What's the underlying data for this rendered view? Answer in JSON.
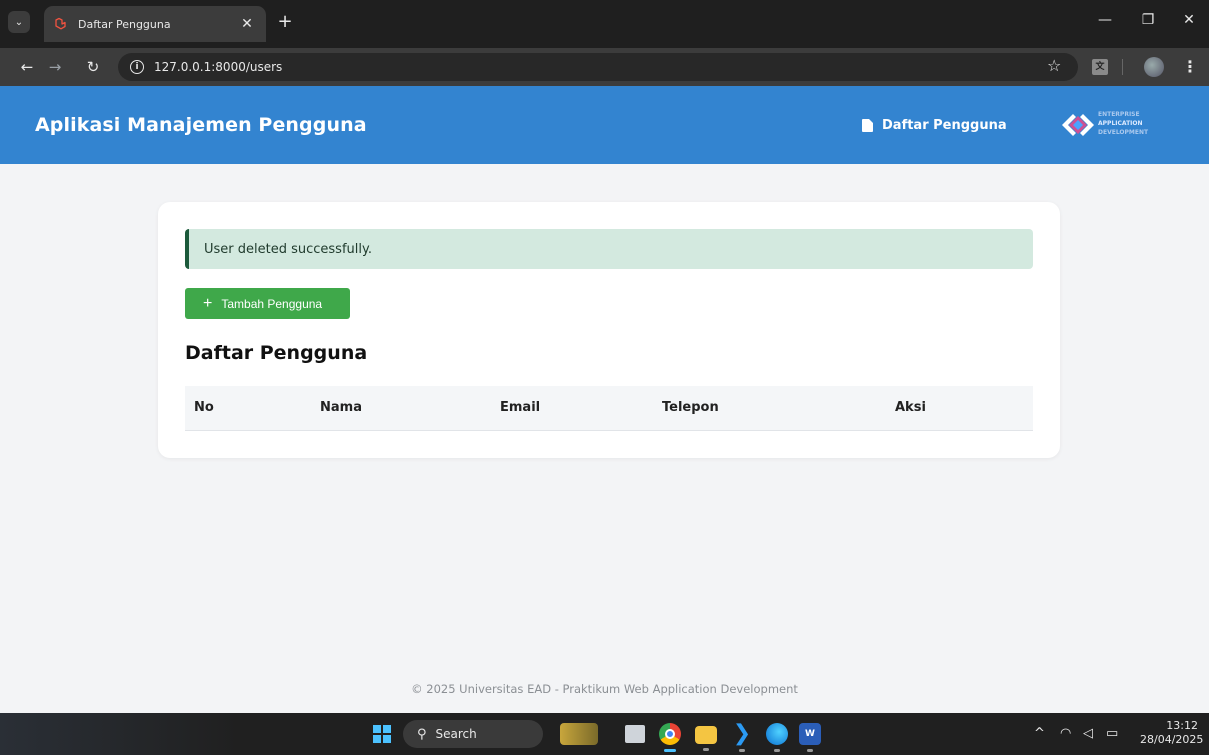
{
  "browser": {
    "tab_title": "Daftar Pengguna",
    "url": "127.0.0.1:8000/users",
    "tab_close_glyph": "✕",
    "new_tab_glyph": "+"
  },
  "header": {
    "app_title": "Aplikasi Manajemen Pengguna",
    "nav_link": "Daftar Pengguna",
    "logo_lines": [
      "ENTERPRISE",
      "APPLICATION",
      "DEVELOPMENT"
    ],
    "background_color": "#3384d0"
  },
  "main": {
    "alert_message": "User deleted successfully.",
    "add_button_label": "Tambah Pengguna",
    "section_title": "Daftar Pengguna",
    "table": {
      "columns": [
        "No",
        "Nama",
        "Email",
        "Telepon",
        "Aksi"
      ],
      "rows": []
    }
  },
  "footer": {
    "text": "© 2025 Universitas EAD - Praktikum Web Application Development"
  },
  "taskbar": {
    "search_label": "Search",
    "time": "13:12",
    "date": "28/04/2025"
  },
  "colors": {
    "alert_bg": "#d3e9df",
    "alert_border": "#1c5a3b",
    "primary_button": "#3fa84a"
  }
}
